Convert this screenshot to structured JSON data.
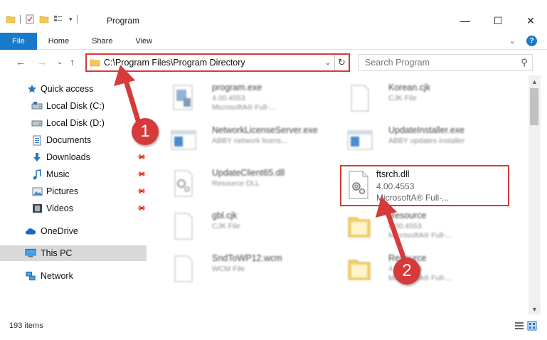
{
  "window": {
    "title": "Program",
    "minimize": "—",
    "maximize": "☐",
    "close": "✕"
  },
  "ribbon": {
    "tabs": [
      {
        "label": "File"
      },
      {
        "label": "Home"
      },
      {
        "label": "Share"
      },
      {
        "label": "View"
      }
    ],
    "expand": "⌄",
    "help": "?"
  },
  "nav": {
    "back": "←",
    "forward": "→",
    "recent": "⌄",
    "up": "↑",
    "address": "C:\\Program Files\\Program Directory",
    "search_placeholder": "Search Program"
  },
  "sidebar": {
    "items": [
      {
        "label": "Quick access",
        "icon": "star-icon"
      },
      {
        "label": "Local Disk (C:)",
        "icon": "drive-icon"
      },
      {
        "label": "Local Disk (D:)",
        "icon": "drive-icon"
      },
      {
        "label": "Documents",
        "icon": "documents-icon"
      },
      {
        "label": "Downloads",
        "icon": "download-icon"
      },
      {
        "label": "Music",
        "icon": "music-icon"
      },
      {
        "label": "Pictures",
        "icon": "pictures-icon"
      },
      {
        "label": "Videos",
        "icon": "videos-icon"
      },
      {
        "label": "OneDrive",
        "icon": "cloud-icon"
      },
      {
        "label": "This PC",
        "icon": "computer-icon"
      },
      {
        "label": "Network",
        "icon": "network-icon"
      }
    ]
  },
  "files": [
    {
      "name": "program.exe",
      "sub1": "4.00.4553",
      "sub2": "MicrosoftA® Full-..."
    },
    {
      "name": "Korean.cjk",
      "sub1": "CJK File",
      "sub2": ""
    },
    {
      "name": "NetworkLicenseServer.exe",
      "sub1": "ABBY network licens...",
      "sub2": ""
    },
    {
      "name": "UpdateInstaller.exe",
      "sub1": "ABBY updates installer",
      "sub2": ""
    },
    {
      "name": "UpdateClient65.dll",
      "sub1": "Resource DLL",
      "sub2": ""
    },
    {
      "name": "gbl.cjk",
      "sub1": "CJK File",
      "sub2": ""
    },
    {
      "name": "Resource",
      "sub1": "4.00.4553",
      "sub2": "MicrosoftA® Full-..."
    },
    {
      "name": "SndToWP12.wcm",
      "sub1": "WCM File",
      "sub2": ""
    },
    {
      "name": "Resource",
      "sub1": "4.00.4553",
      "sub2": "MicrosoftA® Full-..."
    }
  ],
  "highlighted_file": {
    "name": "ftsrch.dll",
    "version": "4.00.4553",
    "description": "MicrosoftA® Full-..."
  },
  "markers": {
    "one": "1",
    "two": "2"
  },
  "status": {
    "count": "193 items"
  },
  "colors": {
    "accent": "#1979ca",
    "annotation": "#d63a3a",
    "folder": "#f3c84b"
  }
}
